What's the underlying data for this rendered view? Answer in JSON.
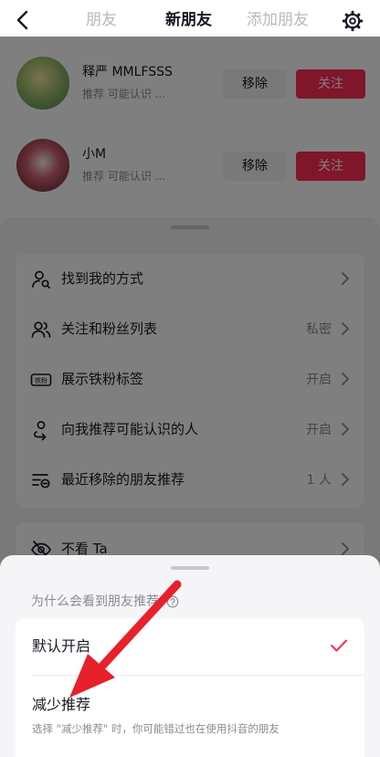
{
  "topnav": {
    "tabs": [
      {
        "label": "朋友"
      },
      {
        "label": "新朋友"
      },
      {
        "label": "添加朋友"
      }
    ]
  },
  "friends": [
    {
      "name": "释严 MMLFSSS",
      "sub": "推荐 可能认识 ...",
      "secondary": "移除",
      "primary": "关注"
    },
    {
      "name": "小M",
      "sub": "推荐 可能认识 ...",
      "secondary": "移除",
      "primary": "关注"
    }
  ],
  "settings": {
    "rows": [
      {
        "label": "找到我的方式",
        "value": ""
      },
      {
        "label": "关注和粉丝列表",
        "value": "私密"
      },
      {
        "label": "展示铁粉标签",
        "value": "开启"
      },
      {
        "label": "向我推荐可能认识的人",
        "value": "开启"
      },
      {
        "label": "最近移除的朋友推荐",
        "value": "1 人"
      }
    ],
    "hide_row": {
      "label": "不看 Ta"
    },
    "iron_fan_badge": "铁粉"
  },
  "sheet": {
    "why_label": "为什么会看到朋友推荐",
    "option_default": "默认开启",
    "option_reduce": "减少推荐",
    "reduce_desc": "选择 \"减少推荐\" 时，你可能错过也在使用抖音的朋友"
  },
  "colors": {
    "accent": "#fe2c55",
    "annotation_arrow": "#e8202a"
  }
}
